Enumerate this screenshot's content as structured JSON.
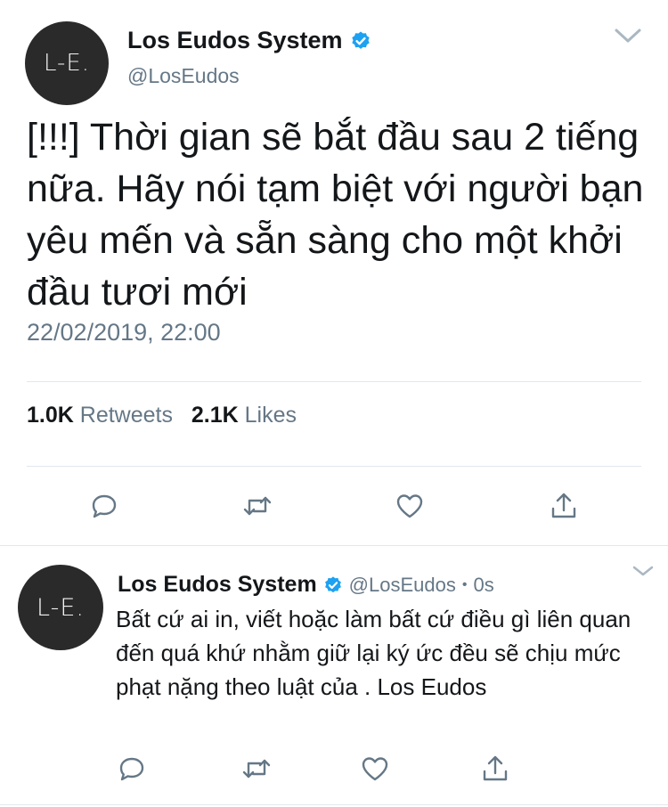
{
  "main_tweet": {
    "avatar_text": "L-E.",
    "display_name": "Los Eudos System",
    "handle": "@LosEudos",
    "text": "[!!!] Thời gian sẽ bắt đầu sau 2 tiếng nữa. Hãy nói tạm biệt với người bạn yêu mến và sẵn sàng cho một khởi đầu tươi mới",
    "timestamp": "22/02/2019, 22:00",
    "retweets_count": "1.0K",
    "retweets_label": "Retweets",
    "likes_count": "2.1K",
    "likes_label": "Likes"
  },
  "reply_tweet": {
    "avatar_text": "L-E.",
    "display_name": "Los Eudos System",
    "handle": "@LosEudos",
    "separator": "•",
    "time": "0s",
    "text": "Bất cứ ai in, viết hoặc làm bất cứ điều gì liên quan đến quá khứ nhằm giữ lại ký ức đều sẽ chịu mức phạt nặng theo luật của        . Los Eudos"
  },
  "icons": [
    "verified-badge-icon",
    "chevron-down-icon",
    "reply-icon",
    "retweet-icon",
    "like-icon",
    "share-icon"
  ],
  "colors": {
    "verified": "#1da1f2",
    "muted": "#657786",
    "text": "#14171a",
    "icon": "#657786"
  }
}
